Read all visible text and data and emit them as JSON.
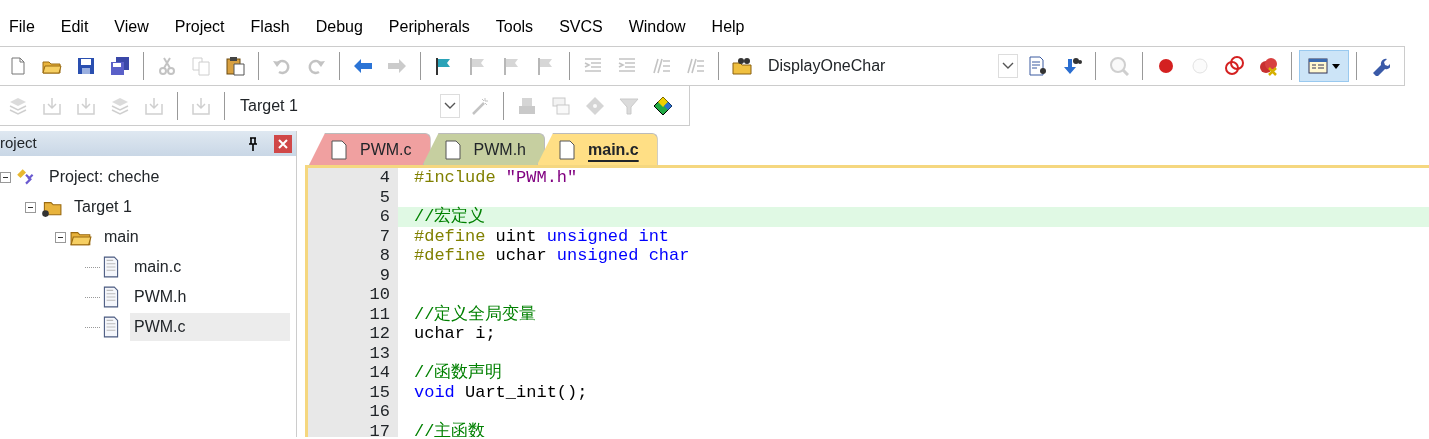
{
  "menu": [
    "File",
    "Edit",
    "View",
    "Project",
    "Flash",
    "Debug",
    "Peripherals",
    "Tools",
    "SVCS",
    "Window",
    "Help"
  ],
  "toolbar_1": [
    {
      "kind": "button",
      "disabled": false
    },
    {
      "kind": "button",
      "disabled": false
    },
    {
      "kind": "button",
      "disabled": false
    },
    {
      "kind": "button",
      "disabled": false
    },
    {
      "kind": "separator"
    },
    {
      "kind": "button",
      "disabled": true
    },
    {
      "kind": "button",
      "disabled": true
    },
    {
      "kind": "button",
      "disabled": false
    },
    {
      "kind": "separator"
    },
    {
      "kind": "button",
      "disabled": true
    },
    {
      "kind": "button",
      "disabled": true
    },
    {
      "kind": "separator"
    },
    {
      "kind": "button",
      "disabled": false
    },
    {
      "kind": "button",
      "disabled": true
    },
    {
      "kind": "separator"
    },
    {
      "kind": "button",
      "disabled": false
    },
    {
      "kind": "button",
      "disabled": true
    },
    {
      "kind": "button",
      "disabled": true
    },
    {
      "kind": "button",
      "disabled": true
    },
    {
      "kind": "separator"
    },
    {
      "kind": "button",
      "disabled": true
    },
    {
      "kind": "button",
      "disabled": true
    },
    {
      "kind": "button",
      "disabled": true
    },
    {
      "kind": "button",
      "disabled": true
    },
    {
      "kind": "separator"
    },
    {
      "kind": "button",
      "disabled": false
    },
    {
      "kind": "combo",
      "value": "DisplayOneChar"
    },
    {
      "kind": "button",
      "disabled": false
    },
    {
      "kind": "button",
      "disabled": false
    },
    {
      "kind": "separator"
    },
    {
      "kind": "button",
      "disabled": true
    },
    {
      "kind": "separator"
    },
    {
      "kind": "button",
      "disabled": false
    },
    {
      "kind": "button",
      "disabled": true
    },
    {
      "kind": "button",
      "disabled": false
    },
    {
      "kind": "button",
      "disabled": false
    },
    {
      "kind": "separator"
    },
    {
      "kind": "split",
      "disabled": false,
      "pressed": true
    },
    {
      "kind": "separator"
    },
    {
      "kind": "button",
      "disabled": false
    }
  ],
  "toolbar_2": [
    {
      "kind": "button",
      "disabled": true
    },
    {
      "kind": "button",
      "disabled": true
    },
    {
      "kind": "button",
      "disabled": true
    },
    {
      "kind": "button",
      "disabled": true
    },
    {
      "kind": "button",
      "disabled": true
    },
    {
      "kind": "separator"
    },
    {
      "kind": "button",
      "disabled": true
    },
    {
      "kind": "separator"
    },
    {
      "kind": "combo",
      "value": "Target 1"
    },
    {
      "kind": "button",
      "disabled": true
    },
    {
      "kind": "separator"
    },
    {
      "kind": "button",
      "disabled": true
    },
    {
      "kind": "button",
      "disabled": true
    },
    {
      "kind": "button",
      "disabled": true
    },
    {
      "kind": "button",
      "disabled": true
    },
    {
      "kind": "button",
      "disabled": false
    }
  ],
  "project_panel": {
    "title": "roject",
    "tree": [
      {
        "label": "Project: cheche",
        "kind": "project",
        "expanded": true,
        "selected": false,
        "children": [
          {
            "label": "Target 1",
            "kind": "target",
            "expanded": true,
            "selected": false,
            "children": [
              {
                "label": "main",
                "kind": "group",
                "expanded": true,
                "selected": false,
                "children": [
                  {
                    "label": "main.c",
                    "kind": "file",
                    "selected": false
                  },
                  {
                    "label": "PWM.h",
                    "kind": "file",
                    "selected": false
                  },
                  {
                    "label": "PWM.c",
                    "kind": "file",
                    "selected": true
                  }
                ]
              }
            ]
          }
        ]
      }
    ]
  },
  "tabs": [
    {
      "label": "PWM.c",
      "selected": false,
      "color": "#f0a0a0"
    },
    {
      "label": "PWM.h",
      "selected": false,
      "color": "#c6cfa0"
    },
    {
      "label": "main.c",
      "selected": true,
      "color": "#ffdf85"
    }
  ],
  "code_lines": [
    {
      "number": "4",
      "current": false,
      "tokens": [
        {
          "kind": "preprocessor",
          "text": "#include "
        },
        {
          "kind": "string",
          "text": "\"PWM.h\""
        }
      ]
    },
    {
      "number": "5",
      "current": false
    },
    {
      "number": "6",
      "current": true,
      "tokens": [
        {
          "kind": "comment",
          "text": "//宏定义"
        }
      ]
    },
    {
      "number": "7",
      "current": false,
      "tokens": [
        {
          "kind": "preprocessor",
          "text": "#define"
        },
        {
          "kind": "plain",
          "text": " uint "
        },
        {
          "kind": "keyword",
          "text": "unsigned int"
        }
      ]
    },
    {
      "number": "8",
      "current": false,
      "tokens": [
        {
          "kind": "preprocessor",
          "text": "#define"
        },
        {
          "kind": "plain",
          "text": " uchar "
        },
        {
          "kind": "keyword",
          "text": "unsigned char"
        }
      ]
    },
    {
      "number": "9",
      "current": false
    },
    {
      "number": "10",
      "current": false
    },
    {
      "number": "11",
      "current": false,
      "tokens": [
        {
          "kind": "comment",
          "text": "//定义全局变量"
        }
      ]
    },
    {
      "number": "12",
      "current": false,
      "tokens": [
        {
          "kind": "plain",
          "text": "uchar i;"
        }
      ]
    },
    {
      "number": "13",
      "current": false
    },
    {
      "number": "14",
      "current": false,
      "tokens": [
        {
          "kind": "comment",
          "text": "//函数声明"
        }
      ]
    },
    {
      "number": "15",
      "current": false,
      "tokens": [
        {
          "kind": "keyword",
          "text": "void"
        },
        {
          "kind": "plain",
          "text": " Uart_init();"
        }
      ]
    },
    {
      "number": "16",
      "current": false
    },
    {
      "number": "17",
      "current": false,
      "tokens": [
        {
          "kind": "comment",
          "text": "//主函数"
        }
      ]
    }
  ]
}
